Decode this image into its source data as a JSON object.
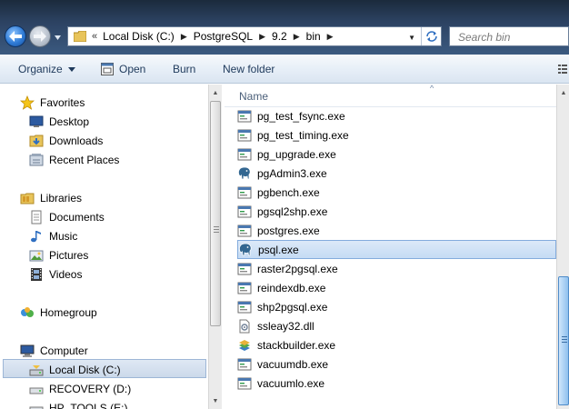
{
  "address_bar": {
    "overflow": "«",
    "crumbs": [
      "Local Disk (C:)",
      "PostgreSQL",
      "9.2",
      "bin"
    ]
  },
  "search": {
    "placeholder": "Search bin"
  },
  "toolbar": {
    "organize": "Organize",
    "open": "Open",
    "burn": "Burn",
    "new_folder": "New folder"
  },
  "nav": {
    "favorites": "Favorites",
    "desktop": "Desktop",
    "downloads": "Downloads",
    "recent_places": "Recent Places",
    "libraries": "Libraries",
    "documents": "Documents",
    "music": "Music",
    "pictures": "Pictures",
    "videos": "Videos",
    "homegroup": "Homegroup",
    "computer": "Computer",
    "local_disk": "Local Disk (C:)",
    "recovery": "RECOVERY (D:)",
    "hp_tools": "HP_TOOLS (E:)"
  },
  "file_list": {
    "column_name": "Name",
    "files": [
      {
        "name": "pg_test_fsync.exe",
        "icon": "exe-icon"
      },
      {
        "name": "pg_test_timing.exe",
        "icon": "exe-icon"
      },
      {
        "name": "pg_upgrade.exe",
        "icon": "exe-icon"
      },
      {
        "name": "pgAdmin3.exe",
        "icon": "elephant-icon"
      },
      {
        "name": "pgbench.exe",
        "icon": "exe-icon"
      },
      {
        "name": "pgsql2shp.exe",
        "icon": "exe-icon"
      },
      {
        "name": "postgres.exe",
        "icon": "exe-icon"
      },
      {
        "name": "psql.exe",
        "icon": "elephant-icon",
        "selected": true
      },
      {
        "name": "raster2pgsql.exe",
        "icon": "exe-icon"
      },
      {
        "name": "reindexdb.exe",
        "icon": "exe-icon"
      },
      {
        "name": "shp2pgsql.exe",
        "icon": "exe-icon"
      },
      {
        "name": "ssleay32.dll",
        "icon": "dll-icon"
      },
      {
        "name": "stackbuilder.exe",
        "icon": "stackbuilder-icon"
      },
      {
        "name": "vacuumdb.exe",
        "icon": "exe-icon"
      },
      {
        "name": "vacuumlo.exe",
        "icon": "exe-icon"
      }
    ]
  }
}
